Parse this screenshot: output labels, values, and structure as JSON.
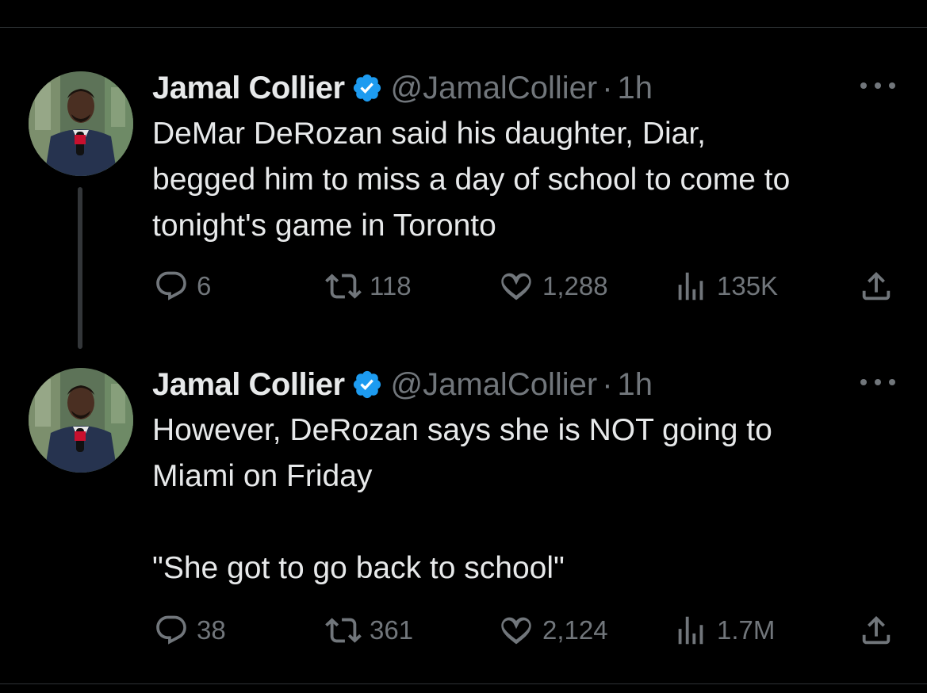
{
  "accent_color": "#1d9bf0",
  "text_color": "#e7e9ea",
  "muted_color": "#71767b",
  "tweets": [
    {
      "author": "Jamal Collier",
      "handle": "@JamalCollier",
      "separator": "·",
      "time": "1h",
      "verified": true,
      "text": "DeMar DeRozan said his daughter, Diar,\nbegged him to miss a day of school to come to\ntonight's game in Toronto",
      "replies": "6",
      "retweets": "118",
      "likes": "1,288",
      "views": "135K"
    },
    {
      "author": "Jamal Collier",
      "handle": "@JamalCollier",
      "separator": "·",
      "time": "1h",
      "verified": true,
      "text": "However, DeRozan says she is NOT going to\nMiami on Friday\n\n\"She got to go back to school\"",
      "replies": "38",
      "retweets": "361",
      "likes": "2,124",
      "views": "1.7M"
    }
  ],
  "icons": {
    "reply": "reply-icon",
    "retweet": "retweet-icon",
    "like": "heart-icon",
    "views": "views-icon",
    "share": "share-icon",
    "verified": "verified-badge-icon",
    "more": "more-icon"
  }
}
